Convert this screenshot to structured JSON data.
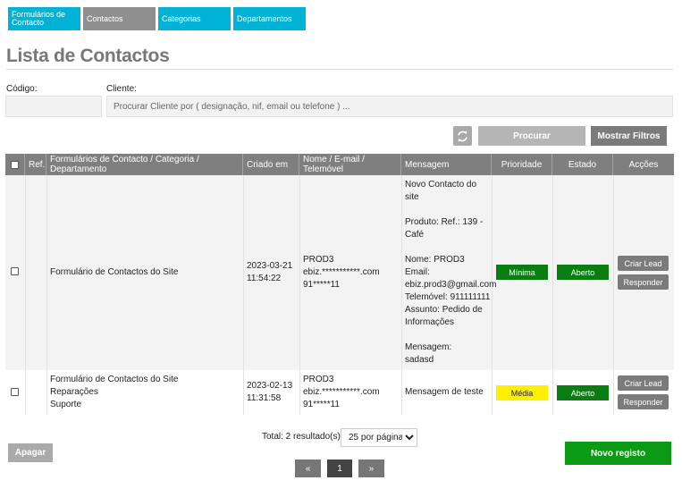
{
  "tabs": [
    {
      "label": "Formulários de Contacto"
    },
    {
      "label": "Contactos"
    },
    {
      "label": "Categorias"
    },
    {
      "label": "Departamentos"
    }
  ],
  "page_title": "Lista de Contactos",
  "filters": {
    "code_label": "Código:",
    "code_value": "",
    "client_label": "Cliente:",
    "client_placeholder": "Procurar Cliente por ( designação, nif, email ou telefone ) ..."
  },
  "buttons": {
    "search": "Procurar",
    "show_filters": "Mostrar Filtros",
    "delete": "Apagar",
    "new_record": "Novo registo"
  },
  "table": {
    "columns": [
      "Ref.",
      "Formulários de Contacto / Categoria / Departamento",
      "Criado em",
      "Nome / E-mail / Telemóvel",
      "Mensagem",
      "Prioridade",
      "Estado",
      "Acções"
    ],
    "rows": [
      {
        "form": [
          "Formulário de Contactos do Site"
        ],
        "created": [
          "2023-03-21",
          "11:54:22"
        ],
        "contact": [
          "PROD3",
          "ebiz.***********.com",
          "91*****11"
        ],
        "message": [
          "Novo Contacto do site",
          "",
          "Produto: Ref.: 139 -",
          "Café",
          "",
          "Nome: PROD3",
          "Email:",
          "ebiz.prod3@gmail.com",
          "Telemóvel: 911111111",
          "Assunto: Pedido de",
          "Informações",
          "",
          "Mensagem:",
          "sadasd"
        ],
        "priority": "Mínima",
        "priority_color": "#0a7d12",
        "status": "Aberto",
        "status_color": "#0a7d12",
        "actions": [
          "Criar Lead",
          "Responder"
        ]
      },
      {
        "form": [
          "Formulário de Contactos do Site",
          "Reparações",
          "Suporte"
        ],
        "created": [
          "2023-02-13",
          "11:31:58"
        ],
        "contact": [
          "PROD3",
          "ebiz.***********.com",
          "91*****11"
        ],
        "message": [
          "Mensagem de teste"
        ],
        "priority": "Média",
        "priority_color": "#ffef00",
        "status": "Aberto",
        "status_color": "#0a7d12",
        "actions": [
          "Criar Lead",
          "Responder"
        ]
      }
    ]
  },
  "pagination": {
    "total": "Total: 2 resultado(s)",
    "per_page": "25 por página",
    "current_page": "1",
    "prev": "«",
    "next": "»"
  },
  "icons": {
    "refresh": "refresh-icon"
  }
}
